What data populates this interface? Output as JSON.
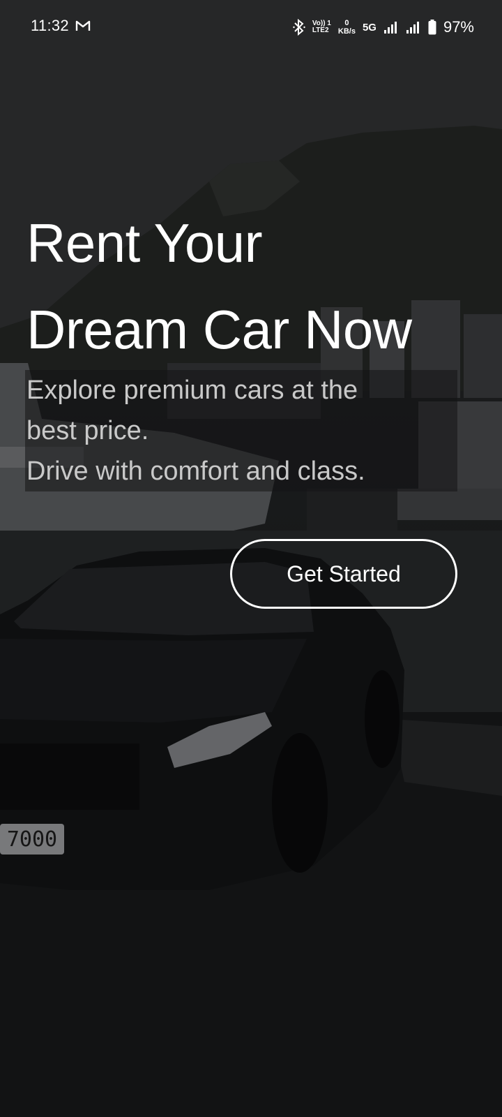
{
  "status_bar": {
    "time": "11:32",
    "notification_icon": "gmail-icon",
    "bluetooth_icon": "bluetooth-icon",
    "volte_line1": "Vo)) 1",
    "volte_line2": "LTE2",
    "speed_value": "0",
    "speed_unit": "KB/s",
    "network": "5G",
    "battery_percent": "97%"
  },
  "hero": {
    "headline_line1": "Rent Your",
    "headline_line2": "Dream Car Now",
    "subtext_line1": "Explore premium cars at the",
    "subtext_line2": "best price.",
    "subtext_line3": "Drive with comfort and class.",
    "cta_label": "Get Started"
  },
  "plate_text": "7000",
  "colors": {
    "headline": "#ffffff",
    "subtext": "#c9c9c9",
    "cta_border": "#ffffff",
    "background": "#1a1c1f"
  }
}
